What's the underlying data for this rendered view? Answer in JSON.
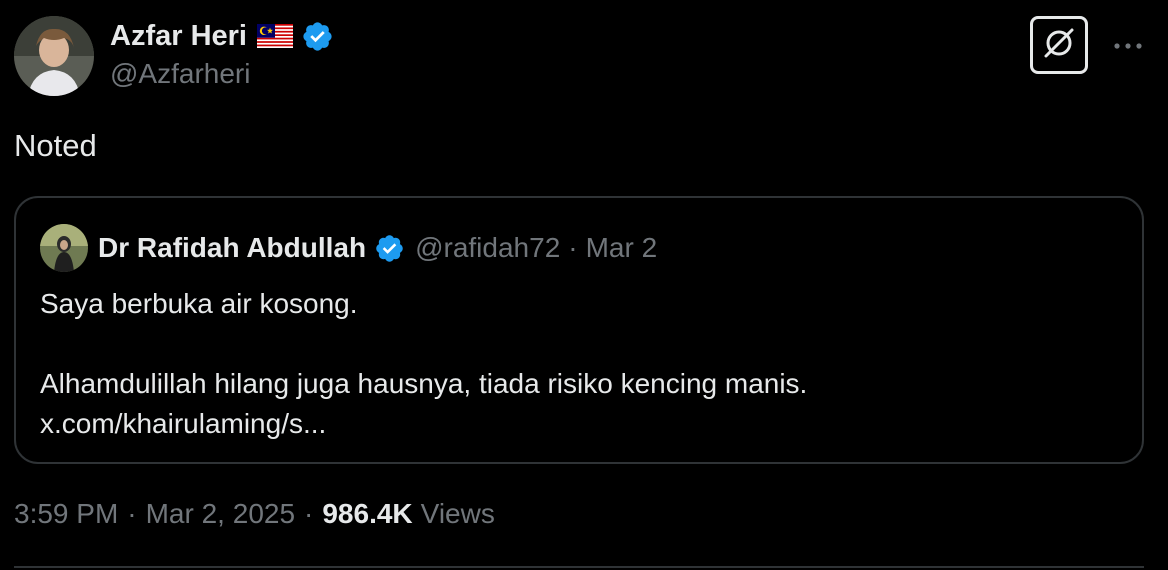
{
  "author": {
    "display_name": "Azfar Heri",
    "handle": "@Azfarheri",
    "flag_icon": "malaysia-flag-icon",
    "verified_icon": "verified-badge-icon"
  },
  "actions": {
    "grok_icon": "grok-icon",
    "more_icon": "more-dots-icon"
  },
  "tweet": {
    "text": "Noted"
  },
  "quote": {
    "name": "Dr Rafidah Abdullah",
    "handle": "@rafidah72",
    "separator": "·",
    "date": "Mar 2",
    "line1": "Saya berbuka air kosong.",
    "line2": "Alhamdulillah hilang juga hausnya, tiada risiko kencing manis.",
    "line3": "x.com/khairulaming/s..."
  },
  "meta": {
    "time": "3:59 PM",
    "separator": "·",
    "date": "Mar 2, 2025",
    "views_count": "986.4K",
    "views_label": "Views"
  },
  "colors": {
    "background": "#000000",
    "text_primary": "#e7e9ea",
    "text_secondary": "#71767b",
    "verified_blue": "#1d9bf0",
    "border": "#2f3336"
  }
}
